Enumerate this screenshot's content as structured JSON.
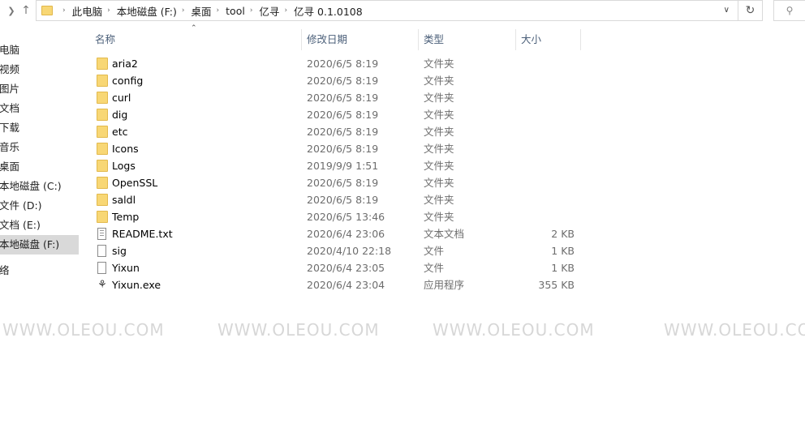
{
  "address_bar": {
    "breadcrumbs": [
      "此电脑",
      "本地磁盘 (F:)",
      "桌面",
      "tool",
      "亿寻",
      "亿寻 0.1.0108"
    ]
  },
  "sidebar": {
    "items": [
      "电脑",
      "视频",
      "图片",
      "文档",
      "下载",
      "音乐",
      "桌面",
      "本地磁盘 (C:)",
      "文件 (D:)",
      "文档 (E:)",
      "本地磁盘 (F:)",
      "络"
    ],
    "selected": "本地磁盘 (F:)"
  },
  "columns": {
    "name": "名称",
    "modified": "修改日期",
    "type": "类型",
    "size": "大小"
  },
  "files": [
    {
      "name": "aria2",
      "modified": "2020/6/5 8:19",
      "type": "文件夹",
      "size": "",
      "icon": "folder-icon"
    },
    {
      "name": "config",
      "modified": "2020/6/5 8:19",
      "type": "文件夹",
      "size": "",
      "icon": "folder-icon"
    },
    {
      "name": "curl",
      "modified": "2020/6/5 8:19",
      "type": "文件夹",
      "size": "",
      "icon": "folder-icon"
    },
    {
      "name": "dig",
      "modified": "2020/6/5 8:19",
      "type": "文件夹",
      "size": "",
      "icon": "folder-icon"
    },
    {
      "name": "etc",
      "modified": "2020/6/5 8:19",
      "type": "文件夹",
      "size": "",
      "icon": "folder-icon"
    },
    {
      "name": "Icons",
      "modified": "2020/6/5 8:19",
      "type": "文件夹",
      "size": "",
      "icon": "folder-icon"
    },
    {
      "name": "Logs",
      "modified": "2019/9/9 1:51",
      "type": "文件夹",
      "size": "",
      "icon": "folder-icon"
    },
    {
      "name": "OpenSSL",
      "modified": "2020/6/5 8:19",
      "type": "文件夹",
      "size": "",
      "icon": "folder-icon"
    },
    {
      "name": "saldl",
      "modified": "2020/6/5 8:19",
      "type": "文件夹",
      "size": "",
      "icon": "folder-icon"
    },
    {
      "name": "Temp",
      "modified": "2020/6/5 13:46",
      "type": "文件夹",
      "size": "",
      "icon": "folder-icon"
    },
    {
      "name": "README.txt",
      "modified": "2020/6/4 23:06",
      "type": "文本文档",
      "size": "2 KB",
      "icon": "text-file-icon"
    },
    {
      "name": "sig",
      "modified": "2020/4/10 22:18",
      "type": "文件",
      "size": "1 KB",
      "icon": "file-icon"
    },
    {
      "name": "Yixun",
      "modified": "2020/6/4 23:05",
      "type": "文件",
      "size": "1 KB",
      "icon": "file-icon"
    },
    {
      "name": "Yixun.exe",
      "modified": "2020/6/4 23:04",
      "type": "应用程序",
      "size": "355 KB",
      "icon": "application-icon"
    }
  ],
  "watermark": [
    "WWW.OLEOU.COM",
    "WWW.OLEOU.COM",
    "WWW.OLEOU.COM",
    "WWW.OLEOU.COM"
  ],
  "colors": {
    "header_text": "#4c607a",
    "secondary_text": "#6d6d6d",
    "folder": "#f8d775",
    "selected_bg": "#d9d9d9"
  }
}
